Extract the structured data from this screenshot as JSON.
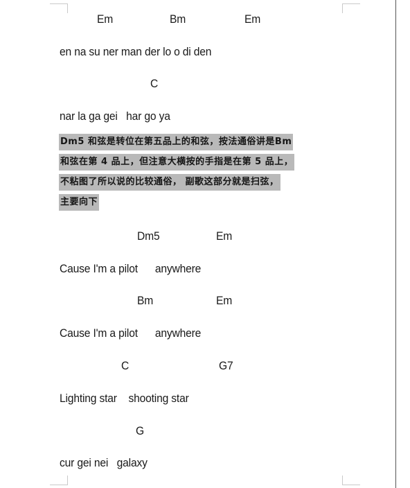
{
  "document": {
    "type": "chord-lyric-sheet",
    "highlight_color": "#b9b9b9",
    "text_color": "#1a1a1a",
    "page_edge_color": "#545454",
    "corner_mark_color": "#c9c9c9"
  },
  "sections": [
    {
      "chords": "Em               Bm                 Em",
      "lyrics": "en na su ner man der lo o di den"
    },
    {
      "chords": "C",
      "lyrics": "nar la ga gei   har go ya"
    },
    {
      "chords": "Dm5          Em",
      "lyrics": "Cause I'm a pilot      anywhere"
    },
    {
      "chords": "Bm          Em",
      "lyrics": "Cause I'm a pilot      anywhere"
    },
    {
      "chords": "C                    G7",
      "lyrics": "Lighting star    shooting star"
    },
    {
      "chords": "G",
      "lyrics": "cur gei nei   galaxy"
    }
  ],
  "lines": {
    "chord_1": "Em",
    "chord_2": "Bm",
    "chord_3": "Em",
    "lyric_1": "en na su ner man der lo o di den",
    "chord_4": "C",
    "lyric_2": "nar la ga gei   har go ya",
    "chord_5": "Dm5",
    "chord_6": "Em",
    "lyric_3": "Cause I'm a pilot      anywhere",
    "chord_7": "Bm",
    "chord_8": "Em",
    "lyric_4": "Cause I'm a pilot      anywhere",
    "chord_9": "C",
    "chord_10": "G7",
    "lyric_5": "Lighting star    shooting star",
    "chord_11": "G",
    "lyric_6": "cur gei nei   galaxy"
  },
  "note": {
    "line_1": "Dm5 和弦是转位在第五品上的和弦，按法通俗讲是Bm",
    "line_2": "和弦在第 4 品上，但注意大横按的手指是在第 5 品上，",
    "line_3": "不粘图了所以说的比较通俗， 副歌这部分就是扫弦，",
    "line_4": "主要向下"
  }
}
